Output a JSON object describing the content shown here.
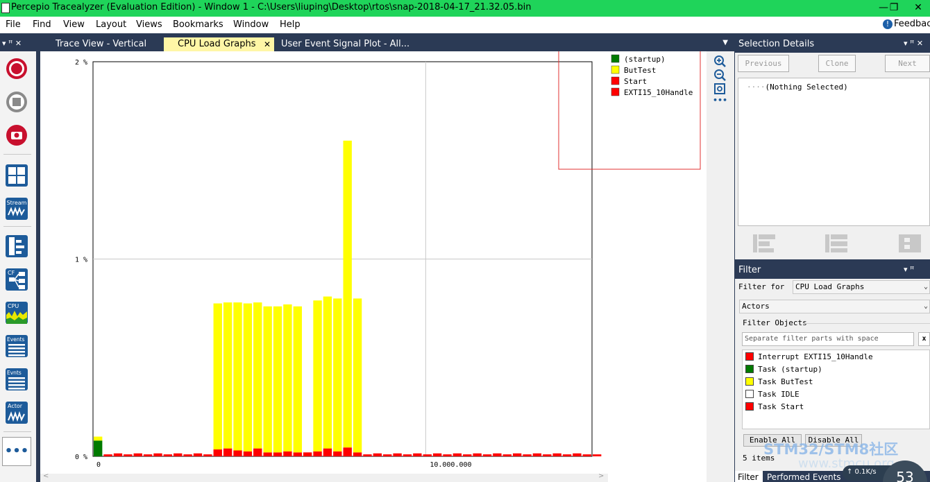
{
  "window": {
    "title": "Percepio Tracealyzer (Evaluation Edition) - Window 1 - C:\\Users\\liuping\\Desktop\\rtos\\snap-2018-04-17_21.32.05.bin",
    "minimize": "—",
    "restore": "❐",
    "close": "✕"
  },
  "menu": [
    "File",
    "Find",
    "View",
    "Layout",
    "Views",
    "Bookmarks",
    "Window",
    "Help"
  ],
  "feedback": "Feedbac",
  "toolbar": {
    "header_pin": "▾ ꟸ ✕",
    "stream_label": "Stream",
    "cf_label": "CF",
    "cpu_label": "CPU",
    "events_label": "Events",
    "evnts_label": "Evnts",
    "actor_label": "Actor",
    "more_label": "•••"
  },
  "tabs": [
    {
      "label": "Trace View - Vertical",
      "active": false
    },
    {
      "label": "CPU Load Graphs",
      "active": true,
      "close": "✕"
    },
    {
      "label": "User Event Signal Plot - All...",
      "active": false
    }
  ],
  "tab_menu": "▼",
  "zoom_tools": {
    "zoom_in": "+",
    "zoom_out": "−",
    "fit": "▣",
    "more": "•••"
  },
  "chart_data": {
    "type": "bar",
    "stacked": true,
    "y_ticks": [
      "0 %",
      "1 %",
      "2 %"
    ],
    "ylim": [
      0,
      2
    ],
    "x_ticks": [
      "0",
      "10.000.000"
    ],
    "x_tick_values": [
      0,
      10000000
    ],
    "xlim": [
      0,
      15000000
    ],
    "grid": true,
    "legend_position": "top-right",
    "legend": [
      {
        "name": "(startup)",
        "color": "#007a00"
      },
      {
        "name": "ButTest",
        "color": "#ffff00"
      },
      {
        "name": "Start",
        "color": "#ff0000"
      },
      {
        "name": "EXTI15_10Handle",
        "color": "#ff0000"
      }
    ],
    "bin_width": 300000,
    "series": [
      {
        "name": "(startup)",
        "color": "#007a00",
        "values": [
          0.08,
          0,
          0,
          0,
          0,
          0,
          0,
          0,
          0,
          0,
          0,
          0,
          0,
          0,
          0,
          0,
          0,
          0,
          0,
          0,
          0,
          0,
          0,
          0,
          0,
          0,
          0,
          0,
          0,
          0,
          0,
          0,
          0,
          0,
          0,
          0,
          0,
          0,
          0,
          0,
          0,
          0,
          0,
          0,
          0,
          0,
          0,
          0,
          0,
          0,
          0
        ]
      },
      {
        "name": "Start",
        "color": "#ff0000",
        "values": [
          0.0,
          0.01,
          0.015,
          0.01,
          0.015,
          0.01,
          0.015,
          0.01,
          0.015,
          0.01,
          0.015,
          0.01,
          0.035,
          0.04,
          0.03,
          0.025,
          0.04,
          0.02,
          0.02,
          0.025,
          0.02,
          0.02,
          0.025,
          0.04,
          0.025,
          0.045,
          0.02,
          0.01,
          0.015,
          0.01,
          0.015,
          0.01,
          0.015,
          0.01,
          0.015,
          0.01,
          0.015,
          0.01,
          0.015,
          0.01,
          0.015,
          0.01,
          0.015,
          0.01,
          0.015,
          0.01,
          0.015,
          0.01,
          0.015,
          0.01,
          0.01
        ]
      },
      {
        "name": "ButTest",
        "color": "#ffff00",
        "values": [
          0.02,
          0,
          0,
          0,
          0,
          0,
          0,
          0,
          0,
          0,
          0,
          0,
          0.74,
          0.74,
          0.75,
          0.75,
          0.74,
          0.74,
          0.74,
          0.745,
          0.74,
          0,
          0.765,
          0.77,
          0.775,
          1.555,
          0.78,
          0,
          0,
          0,
          0,
          0,
          0,
          0,
          0,
          0,
          0,
          0,
          0,
          0,
          0,
          0,
          0,
          0,
          0,
          0,
          0,
          0,
          0,
          0,
          0
        ]
      }
    ]
  },
  "selection_details": {
    "title": "Selection Details",
    "controls": "▾ ꟸ ✕",
    "previous": "Previous",
    "clone": "Clone",
    "next": "Next",
    "tree_item": "(Nothing Selected)"
  },
  "filter": {
    "title": "Filter",
    "controls": "▾ ꟸ",
    "filter_for_label": "Filter for",
    "filter_for_value": "CPU Load Graphs",
    "category_value": "Actors",
    "objects_label": "Filter Objects",
    "search_placeholder": "Separate filter parts with space",
    "clear": "x",
    "objects": [
      {
        "label": "Interrupt EXTI15_10Handle",
        "color": "#ff0000"
      },
      {
        "label": "Task (startup)",
        "color": "#007a00"
      },
      {
        "label": "Task ButTest",
        "color": "#ffff00"
      },
      {
        "label": "Task IDLE",
        "color": "#ffffff"
      },
      {
        "label": "Task Start",
        "color": "#ff0000"
      }
    ],
    "enable_all": "Enable All",
    "disable_all": "Disable All",
    "count": "5 items"
  },
  "bottom_tabs": [
    "Filter",
    "Performed Events"
  ],
  "watermark": {
    "line1": "STM32/STM8社区",
    "line2": "www.stmcu.org"
  },
  "speed": {
    "rate": "↑ 0.1K/s",
    "percent": "53"
  }
}
